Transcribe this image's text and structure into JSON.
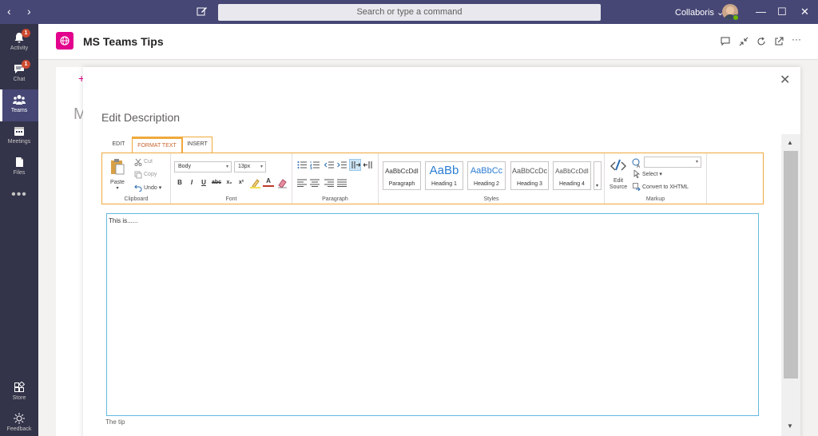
{
  "titlebar": {
    "search_placeholder": "Search or type a command",
    "org": "Collaboris",
    "org_caret": "⌄",
    "back": "‹",
    "forward": "›",
    "minimize": "—",
    "maximize": "☐",
    "close": "✕"
  },
  "rail": {
    "items": [
      {
        "label": "Activity",
        "icon": "bell-icon",
        "badge": "1"
      },
      {
        "label": "Chat",
        "icon": "chat-icon",
        "badge": "1"
      },
      {
        "label": "Teams",
        "icon": "teams-icon",
        "active": true
      },
      {
        "label": "Meetings",
        "icon": "calendar-icon"
      },
      {
        "label": "Files",
        "icon": "file-icon"
      }
    ],
    "more": "•••",
    "bottom": [
      {
        "label": "Store",
        "icon": "store-icon"
      },
      {
        "label": "Feedback",
        "icon": "feedback-icon"
      }
    ]
  },
  "app": {
    "title": "MS Teams Tips",
    "more": "···"
  },
  "bg": {
    "plus": "+",
    "m": "M"
  },
  "dialog": {
    "title": "Edit Description",
    "close": "✕",
    "tabs": [
      "EDIT",
      "FORMAT TEXT",
      "INSERT"
    ],
    "selected_tab": "FORMAT TEXT",
    "clipboard": {
      "paste": "Paste",
      "paste_caret": "▾",
      "cut": "Cut",
      "copy": "Copy",
      "undo": "Undo",
      "undo_caret": "▾",
      "label": "Clipboard"
    },
    "font": {
      "family": "Body",
      "size": "13px",
      "caret": "▾",
      "bold": "B",
      "italic": "I",
      "underline": "U",
      "strike": "abc",
      "subscript": "x₂",
      "superscript": "x²",
      "fontcolor": "A",
      "label": "Font"
    },
    "paragraph": {
      "label": "Paragraph"
    },
    "styles": {
      "items": [
        {
          "sample": "AaBbCcDdI",
          "name": "Paragraph"
        },
        {
          "sample": "AaBb",
          "name": "Heading 1"
        },
        {
          "sample": "AaBbCc",
          "name": "Heading 2"
        },
        {
          "sample": "AaBbCcDc",
          "name": "Heading 3"
        },
        {
          "sample": "AaBbCcDdI",
          "name": "Heading 4"
        }
      ],
      "more_caret": "▾",
      "label": "Styles"
    },
    "markup": {
      "edit_source_1": "Edit",
      "edit_source_2": "Source",
      "language_caret": "▾",
      "select": "Select",
      "select_caret": "▾",
      "convert": "Convert to XHTML",
      "label": "Markup"
    },
    "editor_text": "This is......",
    "tip_label": "The tip",
    "scroll_up": "▲",
    "scroll_down": "▼"
  },
  "colors": {
    "titlebar": "#464775",
    "rail": "#33344a",
    "accent": "#e3008c",
    "ribbon_border": "#f0a93c",
    "editor_border": "#64b9e0"
  }
}
